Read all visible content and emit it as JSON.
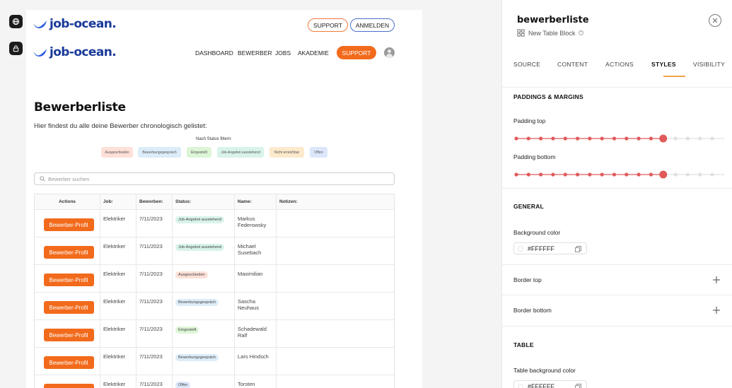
{
  "canvas": {
    "logo_text": "job-ocean.",
    "header": {
      "support_label": "SUPPORT",
      "login_label": "ANMELDEN"
    },
    "nav": {
      "items": [
        "DASHBOARD",
        "BEWERBER",
        "JOBS",
        "AKADEMIE"
      ],
      "support_label": "SUPPORT"
    },
    "page_title": "Bewerberliste",
    "page_subtitle": "Hier findest du alle deine Bewerber chronologisch gelistet:",
    "filter_label": "Nach Status filtern:",
    "filters": [
      {
        "label": "Ausgeschieden",
        "color": "#fde0d8"
      },
      {
        "label": "Bewerbungsgespräch",
        "color": "#dcecf8"
      },
      {
        "label": "Eingestellt",
        "color": "#dcf5d6"
      },
      {
        "label": "Job-Angebot ausstehend",
        "color": "#d8f3ea"
      },
      {
        "label": "Nicht erreichbar",
        "color": "#fde9cc"
      },
      {
        "label": "Offen",
        "color": "#dce6fb"
      }
    ],
    "search_placeholder": "Bewerber suchen",
    "table": {
      "headers": [
        "Actions",
        "Job:",
        "Beworben:",
        "Status:",
        "Name:",
        "Notizen:"
      ],
      "profile_button": "Bewerber-Profil",
      "rows": [
        {
          "job": "Elektriker",
          "date": "7/11/2023",
          "status": "Job-Angebot ausstehend",
          "status_color": "#d8f3ea",
          "name": "Markus Federowsky"
        },
        {
          "job": "Elektriker",
          "date": "7/11/2023",
          "status": "Job-Angebot ausstehend",
          "status_color": "#d8f3ea",
          "name": "Michael Susebach"
        },
        {
          "job": "Elektriker",
          "date": "7/11/2023",
          "status": "Ausgeschieden",
          "status_color": "#fde0d8",
          "name": "Maximilian"
        },
        {
          "job": "Elektriker",
          "date": "7/11/2023",
          "status": "Bewerbungsgespräch",
          "status_color": "#dcecf8",
          "name": "Sascha Neuhaus"
        },
        {
          "job": "Elektriker",
          "date": "7/11/2023",
          "status": "Eingestellt",
          "status_color": "#dcf5d6",
          "name": "Schadewald Ralf"
        },
        {
          "job": "Elektriker",
          "date": "7/11/2023",
          "status": "Bewerbungsgespräch",
          "status_color": "#dcecf8",
          "name": "Lars Hindsch"
        },
        {
          "job": "Elektriker",
          "date": "7/11/2023",
          "status": "Offen",
          "status_color": "#dce6fb",
          "name": "Torsten"
        }
      ]
    }
  },
  "panel": {
    "title": "bewerberliste",
    "subtitle": "New Table Block",
    "tabs": [
      "SOURCE",
      "CONTENT",
      "ACTIONS",
      "STYLES",
      "VISIBILITY"
    ],
    "active_tab": "STYLES",
    "paddings_section": "PADDINGS & MARGINS",
    "padding_top_label": "Padding top",
    "padding_top_level": 0.7,
    "padding_bottom_label": "Padding bottom",
    "padding_bottom_level": 0.7,
    "general_section": "GENERAL",
    "bg_color_label": "Background color",
    "bg_color_value": "#FFFFFF",
    "border_top_label": "Border top",
    "border_bottom_label": "Border bottom",
    "table_section": "TABLE",
    "table_bg_label": "Table background color",
    "table_bg_value": "#FFFFFF"
  },
  "colors": {
    "accent": "#f26a1b",
    "brand": "#1a3a9a",
    "slider_active": "#e05a5a",
    "slider_inactive": "#e0e0e0"
  }
}
